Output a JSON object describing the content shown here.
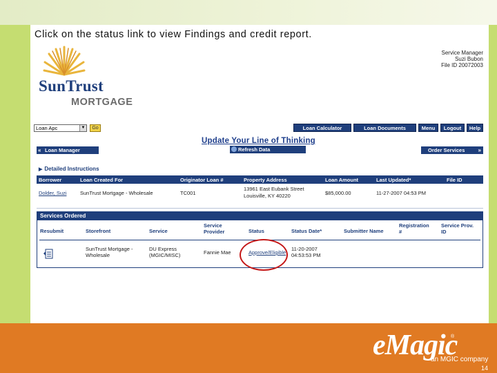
{
  "instruction": "Click on the status link to view Findings and credit report.",
  "service_info": {
    "line1": "Service Manager",
    "line2": "Suzi Bubon",
    "line3": "File ID 20072003"
  },
  "logo": {
    "name_line1": "SunTrust",
    "name_line2": "MORTGAGE"
  },
  "toolbar": {
    "select_value": "Loan Apc",
    "go_label": "Go",
    "buttons": [
      "Loan Calculator",
      "Loan Documents",
      "Menu",
      "Logout",
      "Help"
    ]
  },
  "update_title": "Update Your Line of Thinking",
  "refresh_label": "Refresh Data",
  "loan_manager_label": "Loan Manager",
  "order_services_label": "Order Services",
  "detailed_instructions": "Detailed Instructions",
  "loan_table": {
    "headers": [
      "Borrower",
      "Loan Created For",
      "Originator Loan #",
      "Property Address",
      "Loan Amount",
      "Last Updated*",
      "File ID"
    ],
    "row": {
      "borrower": "Dolder, Suzi",
      "created_for": "SunTrust Mortgage - Wholesale",
      "originator_loan": "TC001",
      "address_line1": "13961 East Eubank Street",
      "address_line2": "Louisville, KY 40220",
      "loan_amount": "$85,000.00",
      "last_updated": "11-27-2007 04:53 PM",
      "file_id": ""
    }
  },
  "services": {
    "title": "Services Ordered",
    "headers": {
      "resubmit": "Resubmit",
      "storefront": "Storefront",
      "service": "Service",
      "provider_line1": "Service",
      "provider_line2": "Provider",
      "status": "Status",
      "status_date": "Status Date*",
      "submitter": "Submitter Name",
      "registration_line1": "Registration",
      "registration_line2": "#",
      "service_prov_line1": "Service Prov.",
      "service_prov_line2": "ID"
    },
    "row": {
      "storefront_line1": "SunTrust Mortgage -",
      "storefront_line2": "Wholesale",
      "service_line1": "DU Express",
      "service_line2": "(MGIC/MISC)",
      "provider": "Fannie Mae",
      "status": "Approve/Eligible",
      "date_line1": "11-20-2007",
      "date_line2": "04:53:53 PM",
      "submitter": "",
      "registration": "",
      "service_prov_id": ""
    }
  },
  "brand": {
    "name": "eMagic",
    "tm": "®",
    "tagline": "an MGIC company"
  },
  "page_number": "14",
  "colors": {
    "green_band": "#c5dd71",
    "orange_band": "#e07a23",
    "navy": "#1f3f7c",
    "highlight_red": "#c41818"
  }
}
